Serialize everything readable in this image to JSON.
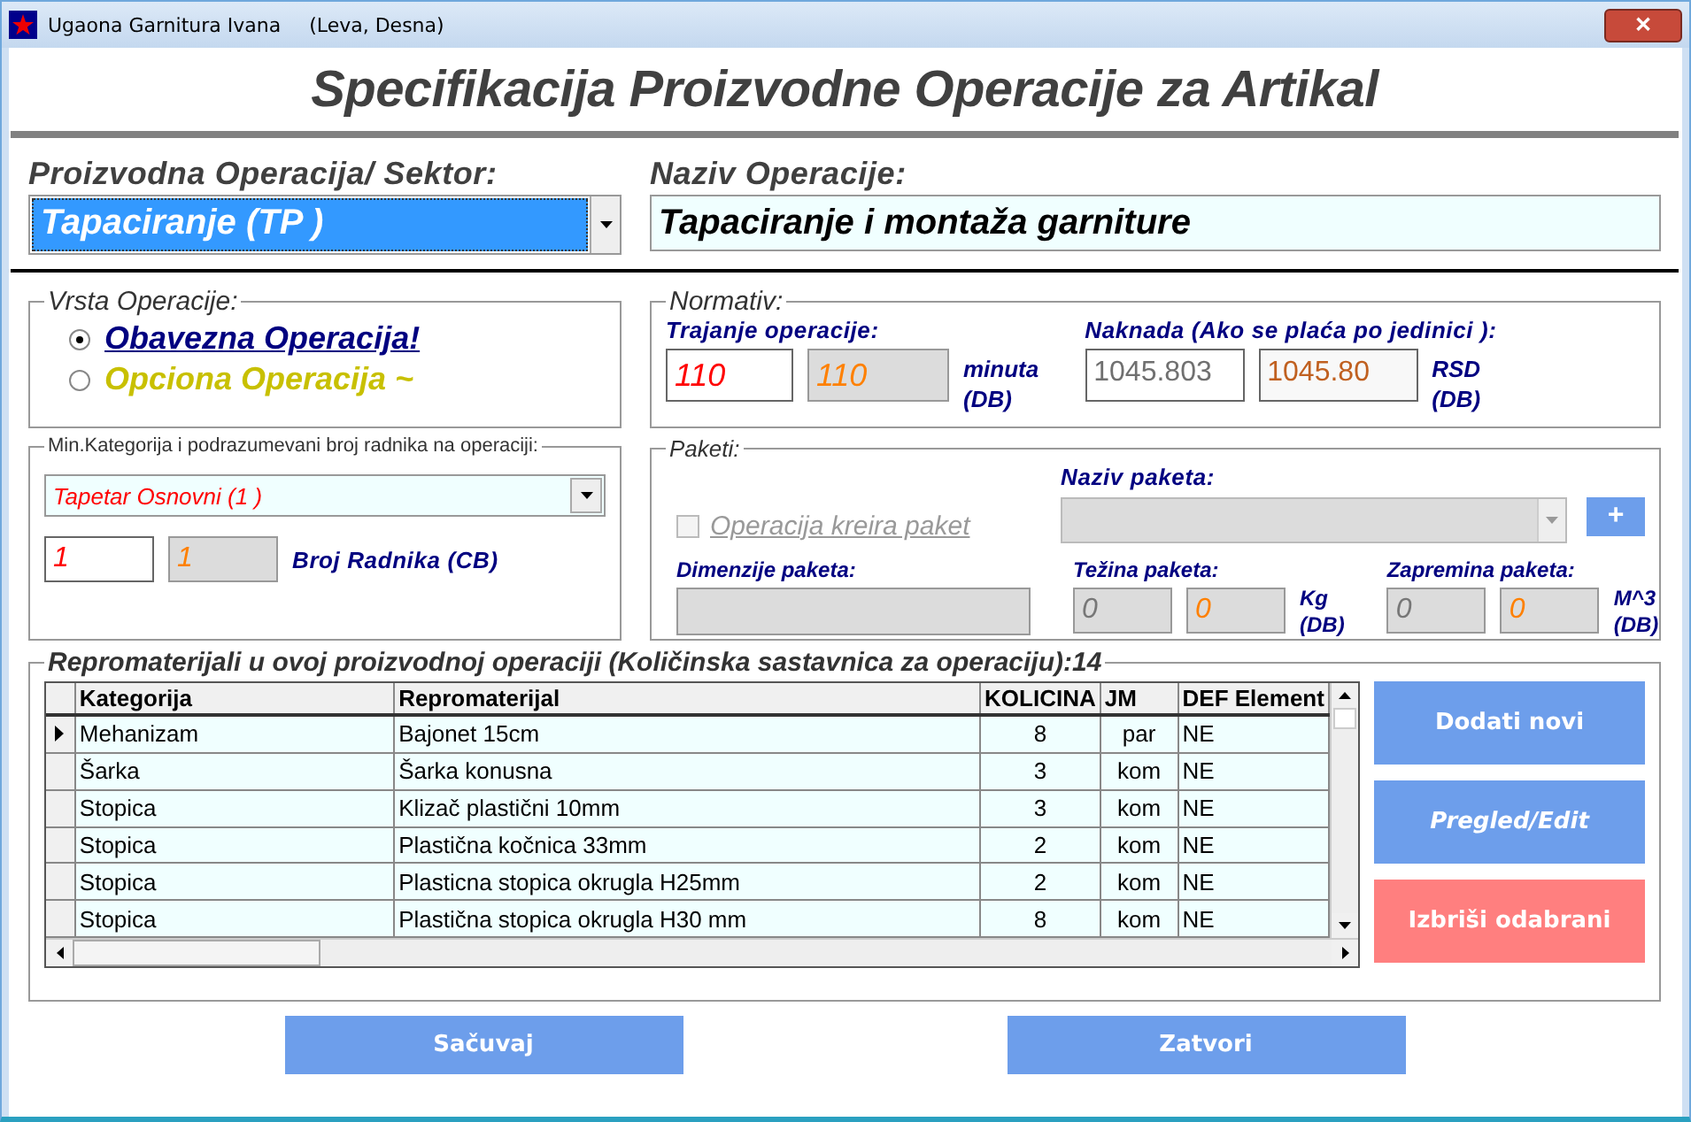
{
  "window": {
    "title": "Ugaona Garnitura  Ivana",
    "subtitle": "(Leva, Desna)",
    "close": "✕"
  },
  "heading": "Specifikacija Proizvodne Operacije za Artikal",
  "operation": {
    "label": "Proizvodna Operacija/ Sektor:",
    "value": "Tapaciranje (TP )"
  },
  "name": {
    "label": "Naziv Operacije:",
    "value": "Tapaciranje i montaža garniture"
  },
  "type_group": {
    "legend": "Vrsta Operacije:",
    "options": [
      {
        "label": "Obavezna Operacija!",
        "selected": true,
        "color": "#000080"
      },
      {
        "label": "Opciona Operacija ~",
        "selected": false,
        "color": "#c8c000"
      }
    ]
  },
  "normativ": {
    "legend": "Normativ:",
    "duration_label": "Trajanje operacije:",
    "duration": "110",
    "duration_db": "110",
    "duration_unit": "minuta",
    "duration_unit_db": "(DB)",
    "fee_label": "Naknada (Ako se plaća po jedinici ):",
    "fee": "1045.803",
    "fee_db": "1045.80",
    "fee_unit": "RSD",
    "fee_unit_db": "(DB)"
  },
  "workers": {
    "legend": "Min.Kategorija i podrazumevani broj radnika na operaciji:",
    "category": "Tapetar Osnovni (1 )",
    "count": "1",
    "count_db": "1",
    "count_label": "Broj Radnika (CB)"
  },
  "packages": {
    "legend": "Paketi:",
    "creates_label": "Operacija kreira paket",
    "creates_checked": false,
    "name_label": "Naziv paketa:",
    "add": "+",
    "dims_label": "Dimenzije paketa:",
    "weight_label": "Težina paketa:",
    "weight": "0",
    "weight_db": "0",
    "weight_unit": "Kg",
    "weight_unit_db": "(DB)",
    "volume_label": "Zapremina paketa:",
    "volume": "0",
    "volume_db": "0",
    "volume_unit": "M^3",
    "volume_unit_db": "(DB)"
  },
  "materials": {
    "legend": "Repromaterijali u ovoj proizvodnoj operaciji (Količinska sastavnica za operaciju):14",
    "columns": [
      "Kategorija",
      "Repromaterijal",
      "KOLICINA",
      "JM",
      "DEF Element"
    ],
    "rows": [
      {
        "selected": true,
        "cells": [
          "Mehanizam",
          "Bajonet 15cm",
          "8",
          "par",
          "NE"
        ]
      },
      {
        "selected": false,
        "cells": [
          "Šarka",
          "Šarka konusna",
          "3",
          "kom",
          "NE"
        ]
      },
      {
        "selected": false,
        "cells": [
          "Stopica",
          "Klizač plastični 10mm",
          "3",
          "kom",
          "NE"
        ]
      },
      {
        "selected": false,
        "cells": [
          "Stopica",
          "Plastična kočnica 33mm",
          "2",
          "kom",
          "NE"
        ]
      },
      {
        "selected": false,
        "cells": [
          "Stopica",
          "Plasticna stopica okrugla H25mm",
          "2",
          "kom",
          "NE"
        ]
      },
      {
        "selected": false,
        "cells": [
          "Stopica",
          "Plastična stopica okrugla H30 mm",
          "8",
          "kom",
          "NE"
        ]
      }
    ],
    "actions": [
      {
        "label": "Dodati novi",
        "kind": "normal"
      },
      {
        "label": "Pregled/Edit",
        "kind": "italic"
      },
      {
        "label": "Izbriši odabrani",
        "kind": "danger"
      }
    ]
  },
  "footer_buttons": [
    "Sačuvaj",
    "Zatvori"
  ]
}
